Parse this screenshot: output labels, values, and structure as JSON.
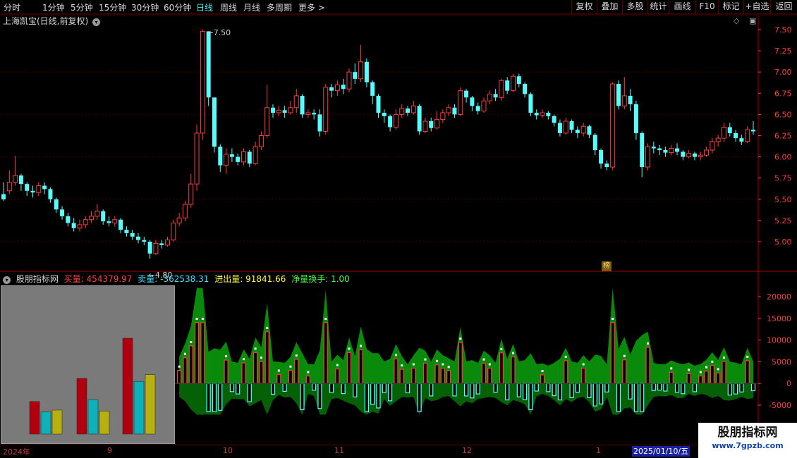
{
  "toolbar": {
    "periods": [
      "分时",
      "1分钟",
      "5分钟",
      "15分钟",
      "30分钟",
      "60分钟",
      "日线",
      "周线",
      "月线",
      "多周期",
      "更多 >"
    ],
    "active_period": "日线",
    "right_buttons": [
      "复权",
      "叠加",
      "多股",
      "统计",
      "画线",
      "F10",
      "标记",
      "+自选",
      "返回"
    ]
  },
  "main_chart": {
    "title": "上海凯宝(日线,前复权)",
    "price_axis": [
      "7.50",
      "7.25",
      "7.00",
      "6.75",
      "6.50",
      "6.25",
      "6.00",
      "5.75",
      "5.50",
      "5.25",
      "5.00"
    ],
    "high_marker": "7.50",
    "low_marker": "4.80",
    "badge": "榜",
    "colors": {
      "up": "#ff3d3d",
      "down": "#54ffff",
      "grid": "#4a0000",
      "axis": "#ff3d3d"
    }
  },
  "chart_data": {
    "type": "candlestick",
    "candles": [
      [
        5.56,
        5.5,
        5.7,
        5.48
      ],
      [
        5.6,
        5.7,
        5.84,
        5.56
      ],
      [
        5.7,
        5.78,
        6.01,
        5.66
      ],
      [
        5.78,
        5.68,
        5.8,
        5.6
      ],
      [
        5.68,
        5.6,
        5.7,
        5.54
      ],
      [
        5.6,
        5.58,
        5.66,
        5.52
      ],
      [
        5.58,
        5.66,
        5.7,
        5.54
      ],
      [
        5.66,
        5.62,
        5.7,
        5.56
      ],
      [
        5.62,
        5.5,
        5.64,
        5.46
      ],
      [
        5.5,
        5.38,
        5.52,
        5.34
      ],
      [
        5.38,
        5.3,
        5.42,
        5.26
      ],
      [
        5.3,
        5.22,
        5.34,
        5.18
      ],
      [
        5.22,
        5.16,
        5.28,
        5.12
      ],
      [
        5.16,
        5.2,
        5.26,
        5.12
      ],
      [
        5.2,
        5.26,
        5.3,
        5.16
      ],
      [
        5.26,
        5.3,
        5.36,
        5.22
      ],
      [
        5.3,
        5.36,
        5.44,
        5.26
      ],
      [
        5.36,
        5.24,
        5.38,
        5.2
      ],
      [
        5.24,
        5.22,
        5.3,
        5.18
      ],
      [
        5.22,
        5.26,
        5.3,
        5.18
      ],
      [
        5.26,
        5.14,
        5.28,
        5.1
      ],
      [
        5.14,
        5.1,
        5.18,
        5.06
      ],
      [
        5.1,
        5.06,
        5.14,
        5.02
      ],
      [
        5.06,
        5.02,
        5.1,
        4.98
      ],
      [
        5.02,
        5.0,
        5.06,
        4.96
      ],
      [
        5.0,
        4.86,
        5.02,
        4.8
      ],
      [
        4.86,
        4.98,
        5.02,
        4.84
      ],
      [
        4.98,
        4.96,
        5.02,
        4.92
      ],
      [
        4.96,
        5.02,
        5.06,
        4.94
      ],
      [
        5.02,
        5.22,
        5.26,
        5.0
      ],
      [
        5.22,
        5.28,
        5.34,
        5.18
      ],
      [
        5.28,
        5.44,
        5.48,
        5.24
      ],
      [
        5.44,
        5.68,
        5.8,
        5.4
      ],
      [
        5.68,
        6.28,
        6.38,
        5.6
      ],
      [
        6.28,
        7.48,
        7.5,
        6.2
      ],
      [
        7.48,
        6.7,
        6.9,
        6.6
      ],
      [
        6.7,
        6.12,
        6.4,
        6.05
      ],
      [
        6.12,
        5.9,
        6.15,
        5.82
      ],
      [
        5.9,
        6.03,
        6.1,
        5.8
      ],
      [
        6.03,
        6.0,
        6.1,
        5.94
      ],
      [
        6.0,
        5.94,
        6.04,
        5.9
      ],
      [
        5.94,
        6.06,
        6.1,
        5.9
      ],
      [
        6.06,
        5.92,
        6.08,
        5.88
      ],
      [
        5.92,
        6.12,
        6.18,
        5.9
      ],
      [
        6.12,
        6.25,
        6.3,
        6.08
      ],
      [
        6.25,
        6.58,
        6.85,
        6.22
      ],
      [
        6.58,
        6.52,
        6.62,
        6.46
      ],
      [
        6.52,
        6.55,
        6.6,
        6.48
      ],
      [
        6.55,
        6.52,
        6.6,
        6.46
      ],
      [
        6.52,
        6.58,
        6.66,
        6.5
      ],
      [
        6.58,
        6.72,
        6.8,
        6.52
      ],
      [
        6.72,
        6.5,
        6.74,
        6.46
      ],
      [
        6.5,
        6.52,
        6.56,
        6.46
      ],
      [
        6.52,
        6.5,
        6.56,
        6.44
      ],
      [
        6.5,
        6.3,
        6.56,
        6.24
      ],
      [
        6.3,
        6.82,
        6.86,
        6.26
      ],
      [
        6.82,
        6.78,
        6.86,
        6.7
      ],
      [
        6.78,
        6.85,
        6.9,
        6.72
      ],
      [
        6.85,
        6.8,
        6.92,
        6.74
      ],
      [
        6.8,
        7.0,
        7.04,
        6.76
      ],
      [
        7.0,
        6.92,
        7.1,
        6.86
      ],
      [
        6.92,
        7.12,
        7.32,
        6.88
      ],
      [
        7.12,
        6.88,
        7.16,
        6.82
      ],
      [
        6.88,
        6.72,
        6.9,
        6.62
      ],
      [
        6.72,
        6.52,
        6.74,
        6.46
      ],
      [
        6.52,
        6.48,
        6.56,
        6.4
      ],
      [
        6.48,
        6.35,
        6.5,
        6.3
      ],
      [
        6.35,
        6.5,
        6.56,
        6.32
      ],
      [
        6.5,
        6.57,
        6.62,
        6.46
      ],
      [
        6.57,
        6.52,
        6.6,
        6.48
      ],
      [
        6.52,
        6.6,
        6.66,
        6.5
      ],
      [
        6.6,
        6.3,
        6.62,
        6.26
      ],
      [
        6.3,
        6.42,
        6.46,
        6.28
      ],
      [
        6.42,
        6.34,
        6.46,
        6.3
      ],
      [
        6.34,
        6.44,
        6.54,
        6.32
      ],
      [
        6.44,
        6.52,
        6.56,
        6.4
      ],
      [
        6.52,
        6.58,
        6.62,
        6.48
      ],
      [
        6.58,
        6.5,
        6.62,
        6.46
      ],
      [
        6.5,
        6.78,
        6.82,
        6.48
      ],
      [
        6.78,
        6.7,
        6.8,
        6.64
      ],
      [
        6.7,
        6.6,
        6.72,
        6.54
      ],
      [
        6.6,
        6.54,
        6.64,
        6.5
      ],
      [
        6.54,
        6.66,
        6.7,
        6.52
      ],
      [
        6.66,
        6.74,
        6.78,
        6.62
      ],
      [
        6.74,
        6.7,
        6.8,
        6.66
      ],
      [
        6.7,
        6.9,
        6.92,
        6.66
      ],
      [
        6.9,
        6.78,
        6.94,
        6.74
      ],
      [
        6.78,
        6.95,
        6.98,
        6.76
      ],
      [
        6.95,
        6.86,
        6.98,
        6.82
      ],
      [
        6.86,
        6.74,
        6.88,
        6.7
      ],
      [
        6.74,
        6.52,
        6.76,
        6.48
      ],
      [
        6.52,
        6.49,
        6.56,
        6.44
      ],
      [
        6.49,
        6.52,
        6.56,
        6.46
      ],
      [
        6.52,
        6.48,
        6.54,
        6.44
      ],
      [
        6.48,
        6.4,
        6.5,
        6.36
      ],
      [
        6.4,
        6.28,
        6.44,
        6.24
      ],
      [
        6.28,
        6.42,
        6.46,
        6.26
      ],
      [
        6.42,
        6.32,
        6.44,
        6.28
      ],
      [
        6.32,
        6.28,
        6.36,
        6.22
      ],
      [
        6.28,
        6.36,
        6.4,
        6.24
      ],
      [
        6.36,
        6.26,
        6.38,
        6.22
      ],
      [
        6.26,
        6.08,
        6.28,
        6.02
      ],
      [
        6.08,
        5.92,
        6.1,
        5.86
      ],
      [
        5.92,
        5.88,
        5.96,
        5.84
      ],
      [
        5.88,
        6.86,
        6.88,
        5.84
      ],
      [
        6.86,
        6.6,
        6.9,
        6.56
      ],
      [
        6.6,
        6.72,
        6.94,
        6.56
      ],
      [
        6.72,
        6.62,
        6.8,
        6.54
      ],
      [
        6.62,
        6.28,
        6.66,
        6.2
      ],
      [
        6.28,
        5.88,
        6.3,
        5.76
      ],
      [
        5.88,
        6.12,
        6.16,
        5.84
      ],
      [
        6.12,
        6.1,
        6.18,
        6.04
      ],
      [
        6.1,
        6.08,
        6.14,
        6.02
      ],
      [
        6.08,
        6.05,
        6.12,
        6.0
      ],
      [
        6.05,
        6.1,
        6.14,
        6.02
      ],
      [
        6.1,
        6.06,
        6.16,
        6.02
      ],
      [
        6.06,
        6.0,
        6.08,
        5.96
      ],
      [
        6.0,
        6.04,
        6.08,
        5.98
      ],
      [
        6.04,
        6.0,
        6.06,
        5.96
      ],
      [
        6.0,
        6.02,
        6.06,
        5.96
      ],
      [
        6.02,
        6.08,
        6.12,
        6.0
      ],
      [
        6.08,
        6.18,
        6.22,
        6.04
      ],
      [
        6.18,
        6.22,
        6.26,
        6.12
      ],
      [
        6.22,
        6.35,
        6.4,
        6.18
      ],
      [
        6.35,
        6.28,
        6.4,
        6.24
      ],
      [
        6.28,
        6.22,
        6.32,
        6.18
      ],
      [
        6.22,
        6.18,
        6.26,
        6.14
      ],
      [
        6.18,
        6.32,
        6.36,
        6.16
      ],
      [
        6.32,
        6.3,
        6.42,
        6.26
      ]
    ],
    "price_range": [
      4.8,
      7.5
    ],
    "volume_indicator": {
      "axis_ticks": [
        20000,
        15000,
        10000,
        5000,
        0,
        -5000
      ],
      "range": [
        -7500,
        23000
      ]
    }
  },
  "indicator": {
    "title_icon": "chevron-down-icon",
    "name": "股朋指标网",
    "buy_label": "买量:",
    "buy_value": "454379.97",
    "sell_label": "卖量:",
    "sell_value": "-362538.31",
    "net_label": "进出量:",
    "net_value": "91841.66",
    "turnover_label": "净量换手:",
    "turnover_value": "1.00",
    "colors": {
      "buy": "#ff4040",
      "sell": "#40e0ff",
      "net": "#ffff40",
      "turnover": "#40ff40"
    }
  },
  "mini_bars": {
    "groups": [
      {
        "values": [
          0.34,
          0.23,
          0.25
        ]
      },
      {
        "values": [
          0.58,
          0.36,
          0.24
        ]
      },
      {
        "values": [
          1.0,
          0.55,
          0.62
        ]
      }
    ],
    "colors": [
      "#b00010",
      "#10b0b8",
      "#b8b010"
    ]
  },
  "date_axis": {
    "labels": [
      "2024年",
      "9",
      "10",
      "11",
      "12",
      "1"
    ],
    "cursor": "2025/01/10/五"
  },
  "watermark": {
    "line1": "股朋指标网",
    "line2": "www.7gpzb.com"
  }
}
